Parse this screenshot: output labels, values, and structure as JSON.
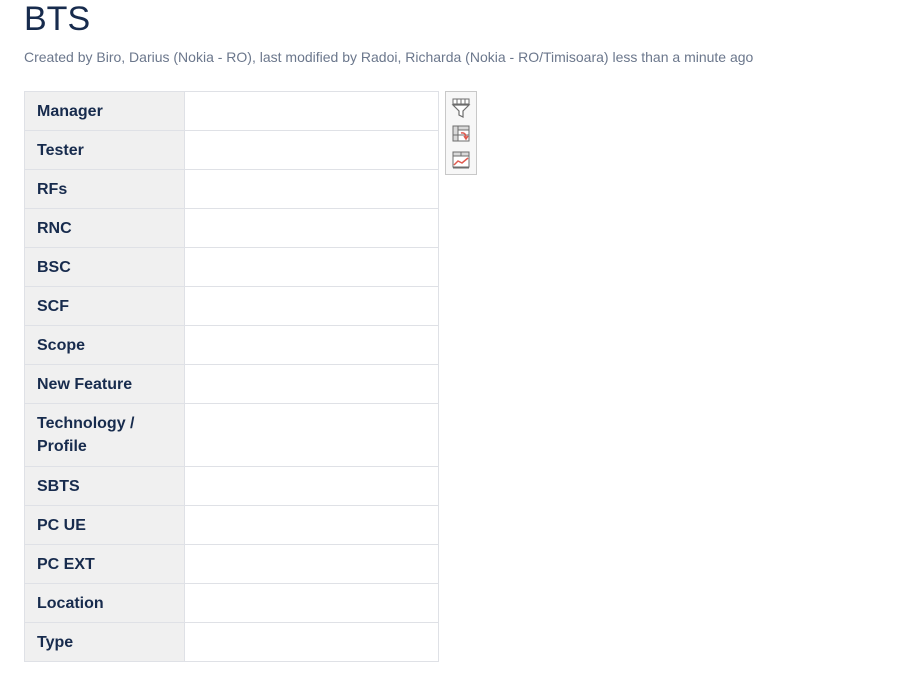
{
  "page": {
    "title": "BTS",
    "byline": {
      "created_prefix": "Created by ",
      "creator": "Biro, Darius (Nokia - RO)",
      "modified_prefix": ", last modified by ",
      "modifier": "Radoi, Richarda (Nokia - RO/Timisoara)",
      "modified_time": " less than a minute ago"
    }
  },
  "properties": {
    "rows": [
      {
        "label": "Manager",
        "value": ""
      },
      {
        "label": "Tester",
        "value": ""
      },
      {
        "label": "RFs",
        "value": ""
      },
      {
        "label": "RNC",
        "value": ""
      },
      {
        "label": "BSC",
        "value": ""
      },
      {
        "label": "SCF",
        "value": ""
      },
      {
        "label": "Scope",
        "value": ""
      },
      {
        "label": "New Feature",
        "value": ""
      },
      {
        "label": "Technology / Profile",
        "value": ""
      },
      {
        "label": "SBTS",
        "value": ""
      },
      {
        "label": "PC UE",
        "value": ""
      },
      {
        "label": "PC EXT",
        "value": ""
      },
      {
        "label": "Location",
        "value": ""
      },
      {
        "label": "Type",
        "value": ""
      }
    ]
  },
  "table_tools": {
    "icons": [
      "table-filter-icon",
      "pivot-table-icon",
      "table-chart-icon"
    ],
    "colors": {
      "grid": "#6d6d6d",
      "accent": "#e05a4f"
    }
  }
}
